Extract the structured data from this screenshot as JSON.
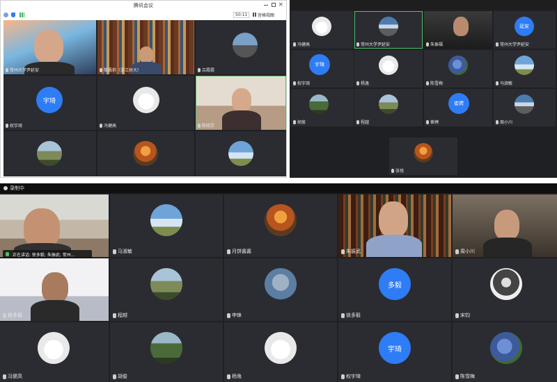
{
  "window_a": {
    "title": "腾讯会议",
    "timer": "50:11",
    "view_label": "宫格视图",
    "tiles": [
      {
        "name": "常州大学尹延安"
      },
      {
        "name": "黎晨莉（浙江财大）"
      },
      {
        "name": "吕霞霞"
      },
      {
        "avatar_text": "宇琦",
        "name": "权宇琦"
      },
      {
        "name": "冯健高"
      },
      {
        "name": "陈晓军"
      },
      {
        "name": ""
      },
      {
        "name": ""
      },
      {
        "name": ""
      }
    ]
  },
  "window_b": {
    "tiles": [
      {
        "name": "冯健高"
      },
      {
        "name": "常州大学尹延安"
      },
      {
        "name": "朱振福"
      },
      {
        "avatar_text": "延安",
        "name": "常州大学尹延安"
      },
      {
        "avatar_text": "宇琦",
        "name": "权宇琦"
      },
      {
        "name": "杨逸"
      },
      {
        "name": "陈雪梅"
      },
      {
        "name": "马淑敏"
      },
      {
        "name": "胡俊"
      },
      {
        "name": "程越"
      },
      {
        "avatar_text": "崔娉",
        "name": "崔娉"
      },
      {
        "name": "周小川"
      },
      {
        "name": "张悦"
      }
    ]
  },
  "window_c": {
    "recording": "录制中",
    "speaking_notice": "正在讲话: 徐多毅; 朱振武; 常州...",
    "tiles": [
      {
        "name": ""
      },
      {
        "name": "马淑敏"
      },
      {
        "name": "月饼酱酱"
      },
      {
        "name": "朱振武"
      },
      {
        "name": "周小川"
      },
      {
        "name": "徐多毅"
      },
      {
        "name": "程越"
      },
      {
        "name": "申锋"
      },
      {
        "avatar_text": "多毅",
        "name": "徐多毅"
      },
      {
        "name": "宋钧"
      },
      {
        "name": "冯健高"
      },
      {
        "name": "胡俊"
      },
      {
        "name": "杨逸"
      },
      {
        "avatar_text": "宇琦",
        "name": "权宇琦"
      },
      {
        "name": "陈雪梅"
      }
    ]
  },
  "colors": {
    "avatar_blue": "#2e7cf6",
    "active_border": "#4ac26b",
    "tile_bg": "#2b2c31"
  },
  "icons": [
    "mic-icon",
    "shield-icon",
    "signal-icon",
    "minimize-icon",
    "maximize-icon",
    "close-icon",
    "grid-view-icon",
    "record-icon"
  ]
}
